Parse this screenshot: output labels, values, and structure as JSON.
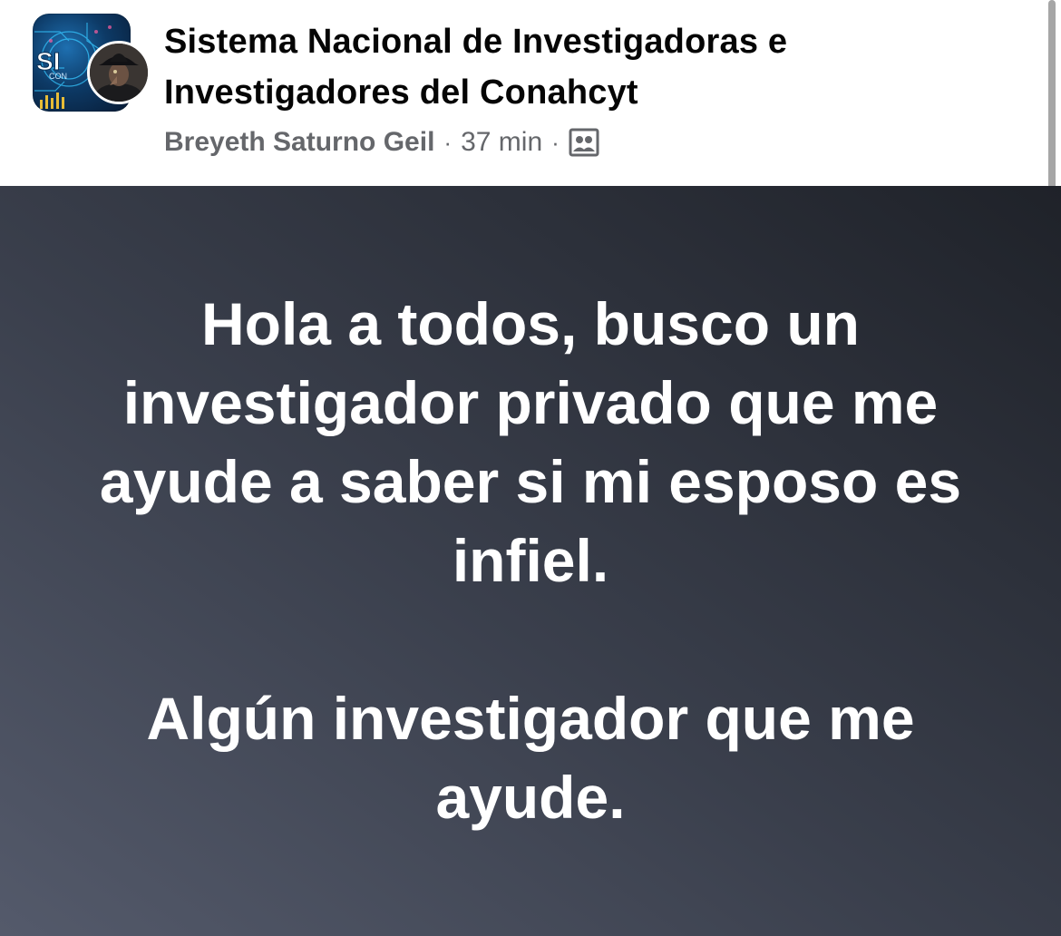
{
  "post": {
    "group_name": "Sistema Nacional de Investigadoras e Investigadores del Conahcyt",
    "author": "Breyeth Saturno Geil",
    "separator": "·",
    "timestamp": "37 min",
    "audience_icon": "group-members-icon",
    "paragraph_1": "Hola a todos, busco un investigador privado que me ayude a saber si mi esposo es infiel.",
    "paragraph_2": "Algún investigador que me ayude."
  },
  "colors": {
    "header_bg": "#ffffff",
    "title_text": "#050505",
    "meta_text": "#65676b",
    "post_bg_dark": "#1f2229",
    "post_bg_light": "#545a6b",
    "post_text": "#ffffff"
  }
}
